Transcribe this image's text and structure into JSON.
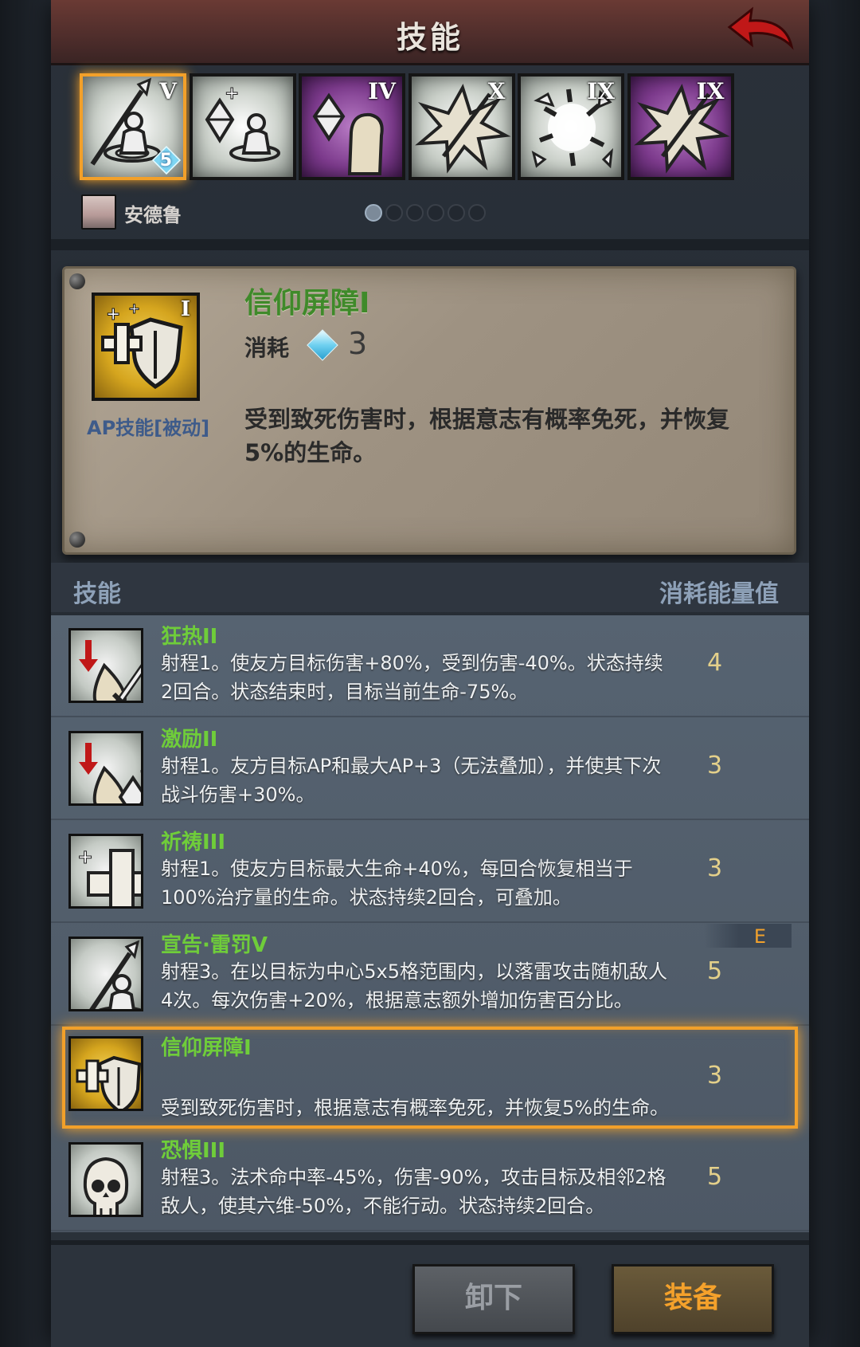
{
  "header": {
    "title": "技能"
  },
  "slots": [
    {
      "roman": "V",
      "style": "light",
      "selected": true,
      "gem_count": "5",
      "icon": "priest-spear-icon"
    },
    {
      "roman": "",
      "style": "light",
      "selected": false,
      "gem_count": "",
      "icon": "priest-crystal-icon"
    },
    {
      "roman": "IV",
      "style": "purple",
      "selected": false,
      "gem_count": "",
      "icon": "crystal-hand-icon"
    },
    {
      "roman": "X",
      "style": "light",
      "selected": false,
      "gem_count": "",
      "icon": "burst-icon"
    },
    {
      "roman": "IX",
      "style": "light",
      "selected": false,
      "gem_count": "",
      "icon": "shatter-icon"
    },
    {
      "roman": "IX",
      "style": "purple",
      "selected": false,
      "gem_count": "",
      "icon": "burst-icon"
    }
  ],
  "character": {
    "name": "安德鲁"
  },
  "pagination": {
    "count": 6,
    "active": 0
  },
  "detail": {
    "name": "信仰屏障I",
    "roman": "I",
    "cost_label": "消耗",
    "cost_value": "3",
    "type": "AP技能[被动]",
    "description": "受到致死伤害时，根据意志有概率免死，并恢复5%的生命。"
  },
  "list_header": {
    "left": "技能",
    "right": "消耗能量值"
  },
  "skills": [
    {
      "name": "狂热II",
      "desc": "射程1。使友方目标伤害+80%，受到伤害-40%。状态持续2回合。状态结束时，目标当前生命-75%。",
      "cost": "4",
      "icon": "drop-sword-icon",
      "gold": false,
      "selected": false,
      "tag": ""
    },
    {
      "name": "激励II",
      "desc": "射程1。友方目标AP和最大AP+3（无法叠加），并使其下次战斗伤害+30%。",
      "cost": "3",
      "icon": "drop-crystal-icon",
      "gold": false,
      "selected": false,
      "tag": ""
    },
    {
      "name": "祈祷III",
      "desc": "射程1。使友方目标最大生命+40%，每回合恢复相当于100%治疗量的生命。状态持续2回合，可叠加。",
      "cost": "3",
      "icon": "holy-cross-icon",
      "gold": false,
      "selected": false,
      "tag": ""
    },
    {
      "name": "宣告·雷罚V",
      "desc": "射程3。在以目标为中心5x5格范围内，以落雷攻击随机敌人4次。每次伤害+20%，根据意志额外增加伤害百分比。",
      "cost": "5",
      "icon": "priest-spear-icon",
      "gold": false,
      "selected": false,
      "tag": "E"
    },
    {
      "name": "信仰屏障I",
      "desc": "受到致死伤害时，根据意志有概率免死，并恢复5%的生命。",
      "cost": "3",
      "icon": "shield-cross-icon",
      "gold": true,
      "selected": true,
      "tag": ""
    },
    {
      "name": "恐惧III",
      "desc": "射程3。法术命中率-45%，伤害-90%，攻击目标及相邻2格敌人，使其六维-50%，不能行动。状态持续2回合。",
      "cost": "5",
      "icon": "skull-icon",
      "gold": false,
      "selected": false,
      "tag": ""
    }
  ],
  "buttons": {
    "unequip": "卸下",
    "equip": "装备"
  }
}
